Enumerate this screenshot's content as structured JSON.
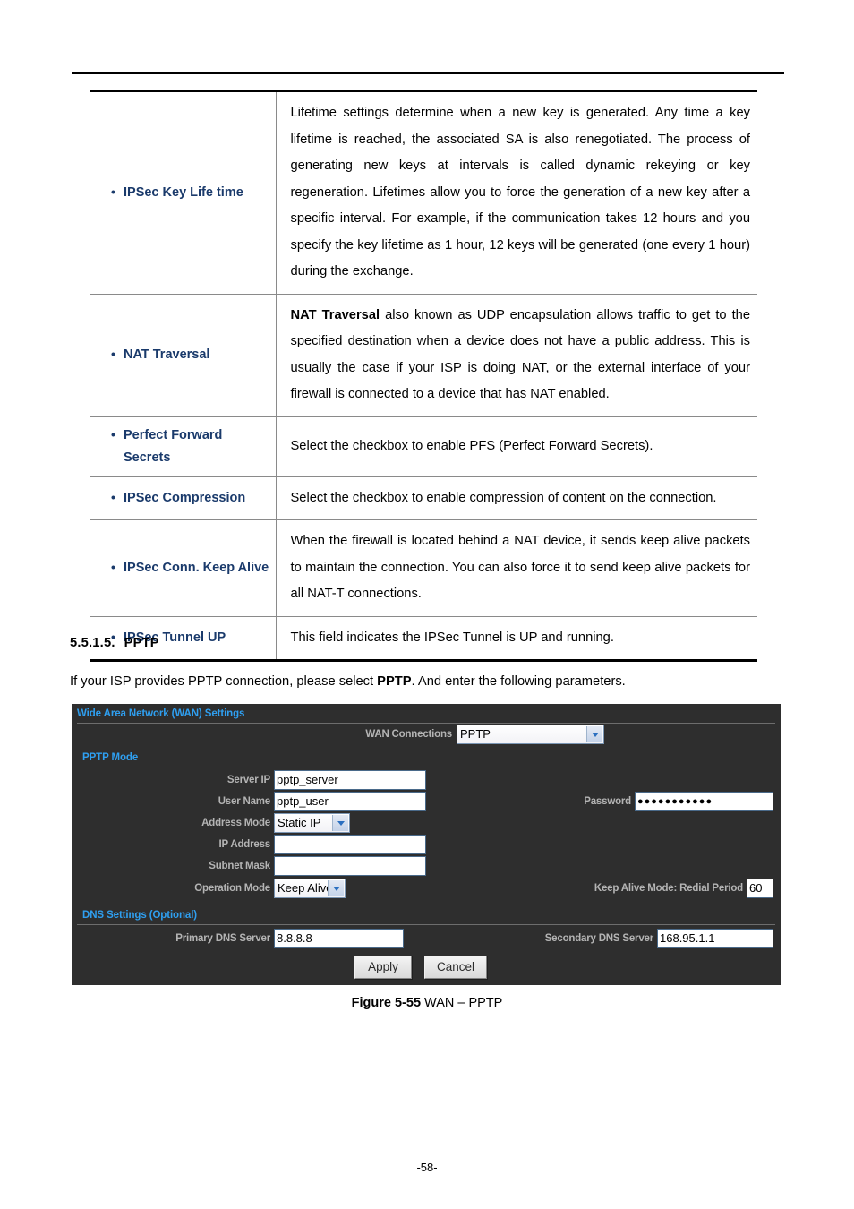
{
  "document": {
    "page_number": "-58-",
    "section": {
      "number": "5.5.1.5.",
      "title": "PPTP"
    },
    "intro": {
      "before": "If your ISP provides PPTP connection, please select ",
      "bold": "PPTP",
      "after": ". And enter the following parameters."
    },
    "figure_caption": {
      "bold": "Figure 5-55",
      "text": " WAN – PPTP"
    }
  },
  "spec_table": {
    "rows": [
      {
        "term": "IPSec Key Life time",
        "description": "Lifetime settings determine when a new key is generated. Any time a key lifetime is reached, the associated SA is also renegotiated. The process of generating new keys at intervals is called dynamic rekeying or key regeneration. Lifetimes allow you to force the generation of a new key after a specific interval. For example, if the communication takes 12 hours and you specify the key lifetime as 1 hour, 12 keys will be generated (one every 1 hour) during the exchange."
      },
      {
        "term": "NAT Traversal",
        "description_bold": "NAT Traversal",
        "description": " also known as UDP encapsulation allows traffic to get to the specified destination when a device does not have a public address. This is usually the case if your ISP is doing NAT, or the external interface of your firewall is connected to a device that has NAT enabled."
      },
      {
        "term": "Perfect Forward Secrets",
        "description": "Select the checkbox to enable PFS (Perfect Forward Secrets)."
      },
      {
        "term": "IPSec Compression",
        "description": "Select the checkbox to enable compression of content on the connection."
      },
      {
        "term": "IPSec Conn. Keep Alive",
        "description": "When the firewall is located behind a NAT device, it sends keep alive packets to maintain the connection. You can also force it to send keep alive packets for all NAT-T connections."
      },
      {
        "term": "IPSec Tunnel UP",
        "description": "This field indicates the IPSec Tunnel is UP and running."
      }
    ]
  },
  "router_ui": {
    "colors": {
      "panel_background": "#2e2e2e",
      "section_title": "#2f9ff0",
      "label": "#b4b4b4",
      "input_background": "#ffffff"
    },
    "wan_section": {
      "title": "Wide Area Network (WAN) Settings",
      "wan_connections_label": "WAN Connections",
      "wan_connections_value": "PPTP"
    },
    "pptp_section": {
      "title": "PPTP Mode",
      "server_ip_label": "Server IP",
      "server_ip_value": "pptp_server",
      "user_name_label": "User Name",
      "user_name_value": "pptp_user",
      "password_label": "Password",
      "password_value": "●●●●●●●●●●●",
      "address_mode_label": "Address Mode",
      "address_mode_value": "Static IP",
      "ip_address_label": "IP Address",
      "ip_address_value": "",
      "subnet_mask_label": "Subnet Mask",
      "subnet_mask_value": "",
      "operation_mode_label": "Operation Mode",
      "operation_mode_value": "Keep Alive",
      "redial_period_label": "Keep Alive Mode: Redial Period",
      "redial_period_value": "60"
    },
    "dns_section": {
      "title": "DNS Settings (Optional)",
      "primary_dns_label": "Primary DNS Server",
      "primary_dns_value": "8.8.8.8",
      "secondary_dns_label": "Secondary DNS Server",
      "secondary_dns_value": "168.95.1.1"
    },
    "buttons": {
      "apply": "Apply",
      "cancel": "Cancel"
    }
  }
}
